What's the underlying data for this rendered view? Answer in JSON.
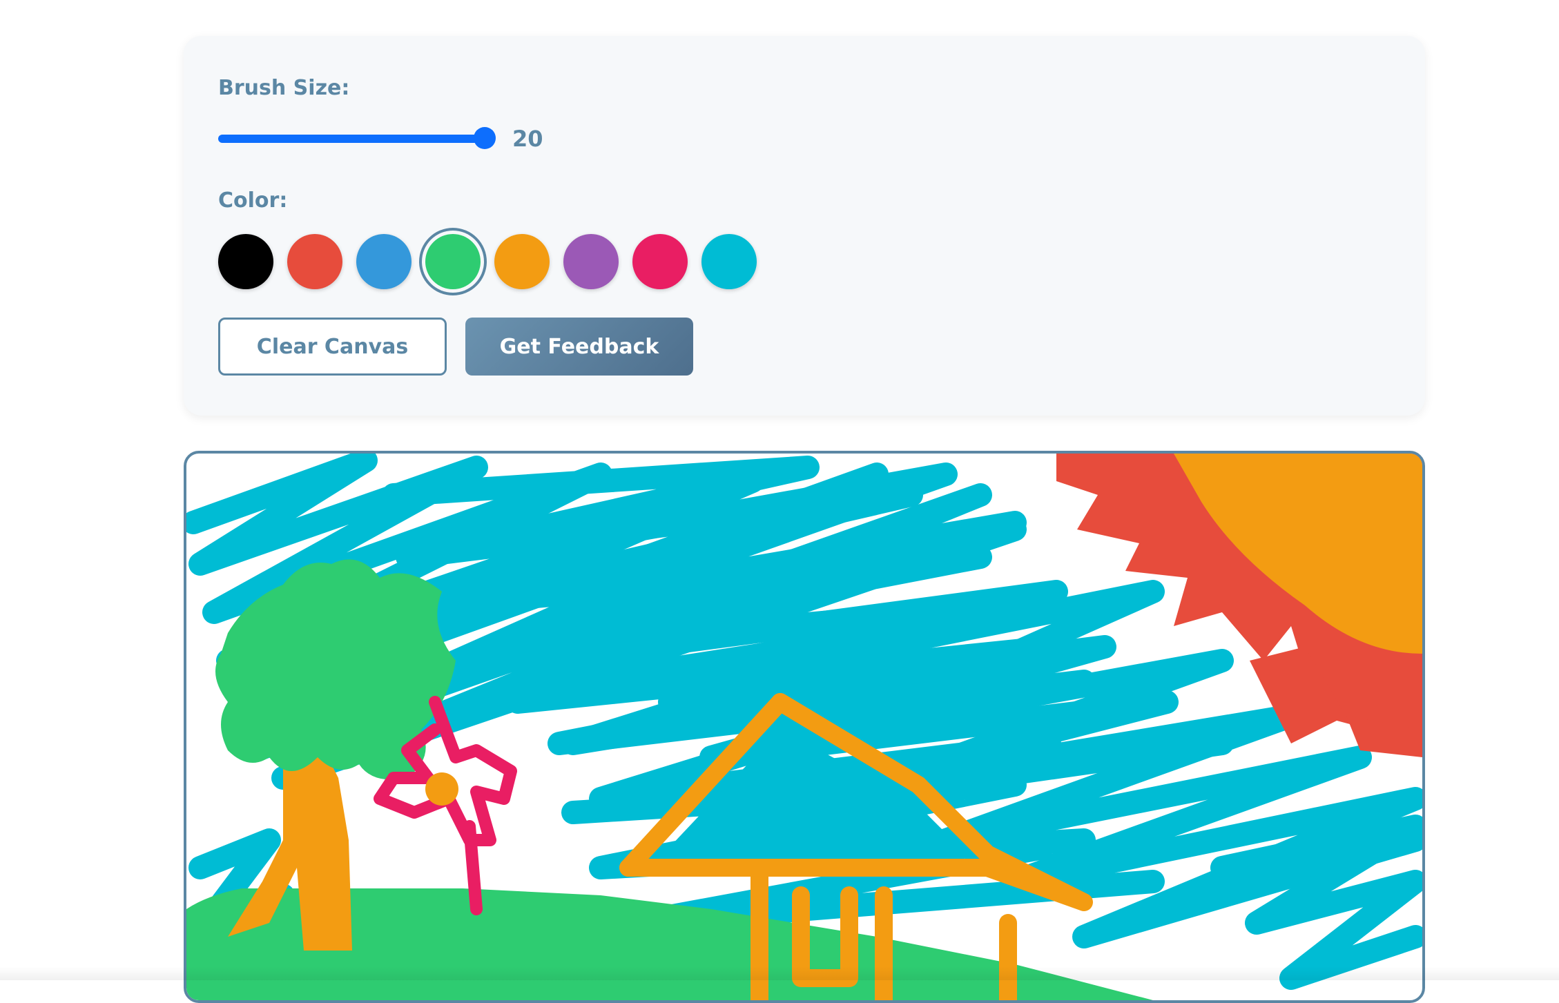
{
  "controls": {
    "brush_label": "Brush Size:",
    "brush_size": 20,
    "brush_size_text": "20",
    "brush_size_fraction": 1.0,
    "color_label": "Color:",
    "colors": [
      {
        "name": "black",
        "hex": "#000000"
      },
      {
        "name": "red",
        "hex": "#e74c3c"
      },
      {
        "name": "blue",
        "hex": "#3498db"
      },
      {
        "name": "green",
        "hex": "#2ecc71"
      },
      {
        "name": "orange",
        "hex": "#f39c12"
      },
      {
        "name": "purple",
        "hex": "#9b59b6"
      },
      {
        "name": "pink",
        "hex": "#e91e63"
      },
      {
        "name": "cyan",
        "hex": "#00bcd4"
      }
    ],
    "selected_color": "green"
  },
  "buttons": {
    "clear_label": "Clear Canvas",
    "feedback_label": "Get Feedback"
  },
  "theme": {
    "accent": "#5b87a4",
    "slider": "#0d6efd",
    "panel_bg": "#f6f8fa"
  }
}
